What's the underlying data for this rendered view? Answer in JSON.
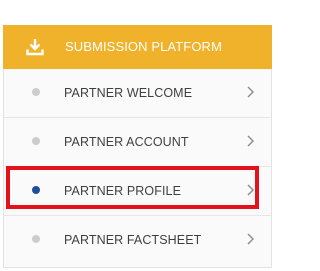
{
  "header": {
    "icon": "download-icon",
    "title": "SUBMISSION PLATFORM",
    "color": "#efb22a"
  },
  "menu": {
    "items": [
      {
        "label": "PARTNER WELCOME",
        "active": false
      },
      {
        "label": "PARTNER ACCOUNT",
        "active": false
      },
      {
        "label": "PARTNER PROFILE",
        "active": true
      },
      {
        "label": "PARTNER FACTSHEET",
        "active": false
      }
    ],
    "active_dot_color": "#1f4e98",
    "inactive_dot_color": "#cccccc",
    "chevron_icon": "chevron-right-icon"
  },
  "highlight": {
    "target": "PARTNER PROFILE",
    "color": "#e3131b"
  }
}
